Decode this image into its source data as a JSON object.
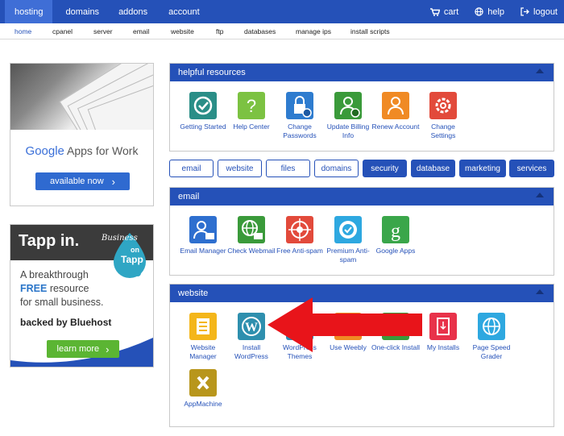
{
  "topnav": {
    "items": [
      "hosting",
      "domains",
      "addons",
      "account"
    ],
    "right": [
      {
        "icon": "cart-icon",
        "label": "cart"
      },
      {
        "icon": "globe-icon",
        "label": "help"
      },
      {
        "icon": "logout-icon",
        "label": "logout"
      }
    ]
  },
  "subnav": {
    "items": [
      "home",
      "cpanel",
      "server",
      "email",
      "website",
      "ftp",
      "databases",
      "manage ips",
      "install scripts"
    ]
  },
  "ads": {
    "google": {
      "logo_word": "Google",
      "product": " Apps for Work",
      "button": "available now"
    },
    "tapp": {
      "title": "Tapp in.",
      "badge_line1": "Business",
      "badge_line2": "on",
      "badge_line3": "Tapp",
      "line1": "A breakthrough",
      "free": "FREE",
      "line2_rest": " resource",
      "line3": "for small business.",
      "backed": "backed by Bluehost",
      "button": "learn more"
    }
  },
  "panels": {
    "helpful": {
      "title": "helpful resources",
      "tiles": [
        {
          "label": "Getting Started",
          "icon": "getting-started-icon",
          "color": "#2a8e87"
        },
        {
          "label": "Help Center",
          "icon": "help-center-icon",
          "color": "#7cc242"
        },
        {
          "label": "Change Passwords",
          "icon": "change-passwords-icon",
          "color": "#2e7ccf"
        },
        {
          "label": "Update Billing Info",
          "icon": "update-billing-icon",
          "color": "#3a9a3a"
        },
        {
          "label": "Renew Account",
          "icon": "renew-account-icon",
          "color": "#f08a24"
        },
        {
          "label": "Change Settings",
          "icon": "change-settings-icon",
          "color": "#e24a3b"
        }
      ]
    },
    "filters": [
      "email",
      "website",
      "files",
      "domains",
      "security",
      "database",
      "marketing",
      "services"
    ],
    "email": {
      "title": "email",
      "tiles": [
        {
          "label": "Email Manager",
          "icon": "email-manager-icon",
          "color": "#2e6fcf"
        },
        {
          "label": "Check Webmail",
          "icon": "check-webmail-icon",
          "color": "#3a9a3a"
        },
        {
          "label": "Free Anti-spam",
          "icon": "free-antispam-icon",
          "color": "#e24a3b"
        },
        {
          "label": "Premium Anti-spam",
          "icon": "premium-antispam-icon",
          "color": "#2ea8e0"
        },
        {
          "label": "Google Apps",
          "icon": "google-apps-icon",
          "color": "#3aa64a"
        }
      ]
    },
    "website": {
      "title": "website",
      "tiles": [
        {
          "label": "Website Manager",
          "icon": "website-manager-icon",
          "color": "#f4b61a"
        },
        {
          "label": "Install WordPress",
          "icon": "wordpress-icon",
          "color": "#2e8fae"
        },
        {
          "label": "WordPress Themes",
          "icon": "wordpress-themes-icon",
          "color": "#2a8bb5"
        },
        {
          "label": "Use Weebly",
          "icon": "weebly-icon",
          "color": "#f08a24"
        },
        {
          "label": "One-click Install",
          "icon": "one-click-install-icon",
          "color": "#3a9a3a"
        },
        {
          "label": "My Installs",
          "icon": "my-installs-icon",
          "color": "#e8324a"
        },
        {
          "label": "Page Speed Grader",
          "icon": "page-speed-icon",
          "color": "#2ea8e0"
        },
        {
          "label": "AppMachine",
          "icon": "appmachine-icon",
          "color": "#b8961c"
        }
      ]
    }
  }
}
